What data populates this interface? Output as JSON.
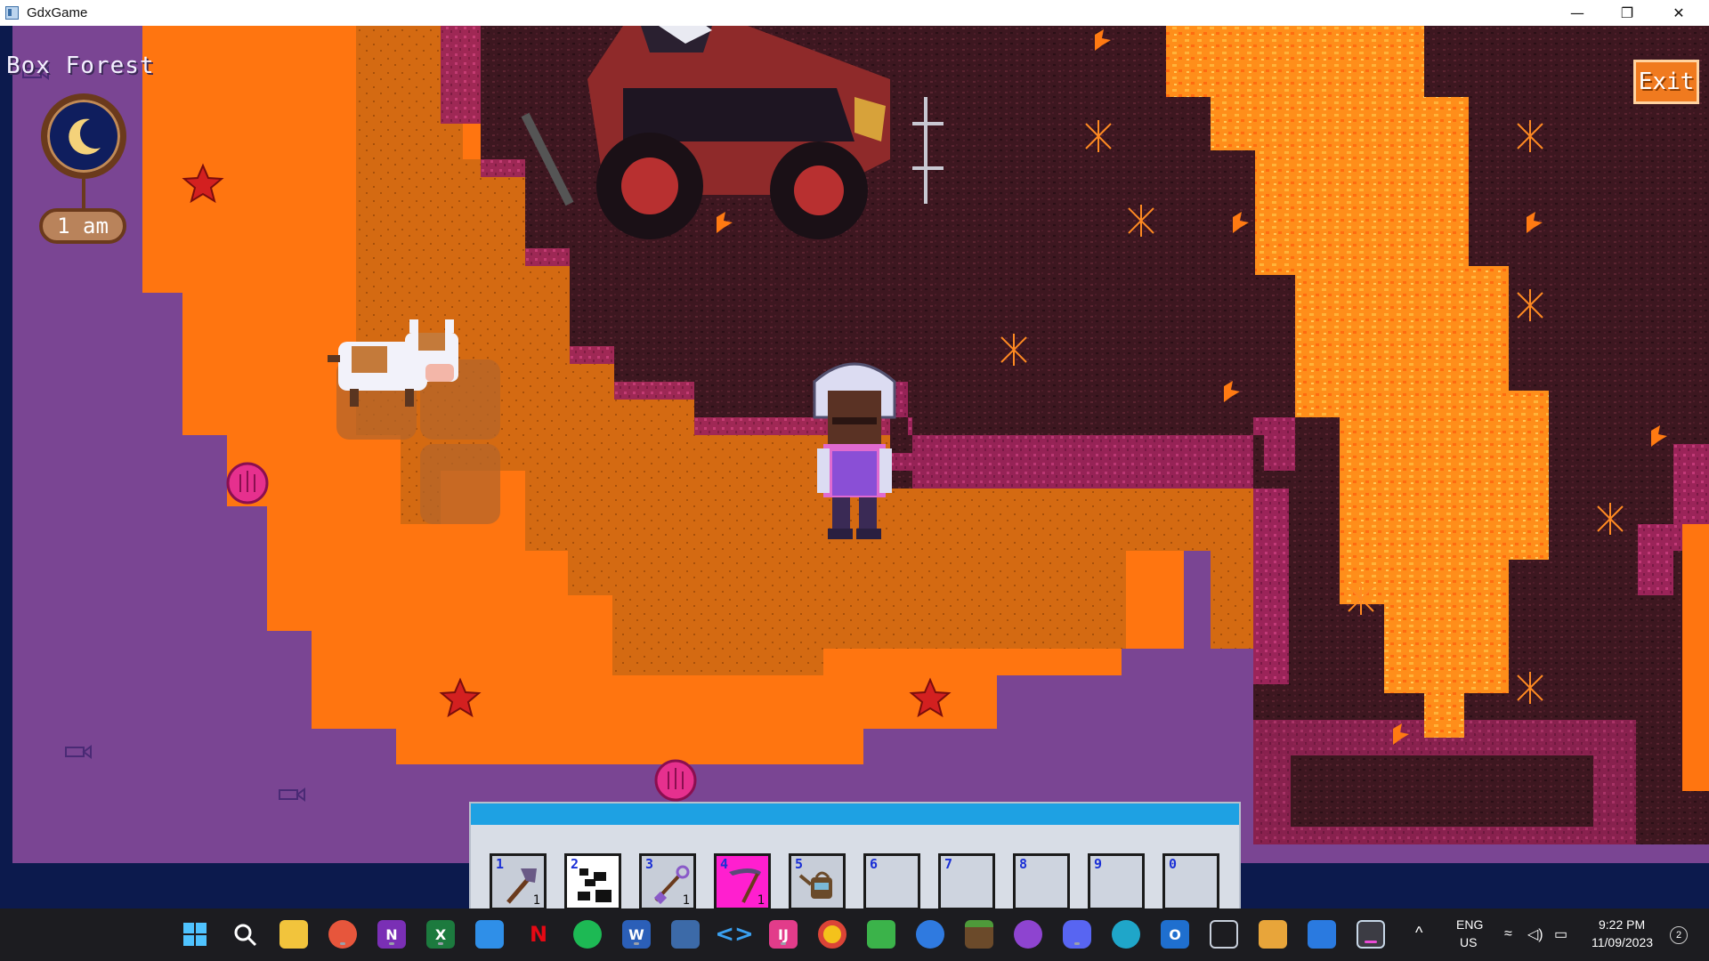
{
  "window": {
    "title": "GdxGame",
    "minimize_glyph": "—",
    "restore_glyph": "❐",
    "close_glyph": "✕"
  },
  "hud": {
    "location": "Box Forest",
    "time": "1 am",
    "exit_label": "Exit",
    "clock_icon": "crescent-moon-icon"
  },
  "hotbar": {
    "selected_index": 3,
    "slots": [
      {
        "number": "1",
        "item": "axe",
        "quantity": "1"
      },
      {
        "number": "2",
        "item": "rock-cluster",
        "quantity": ""
      },
      {
        "number": "3",
        "item": "shovel",
        "quantity": "1"
      },
      {
        "number": "4",
        "item": "scythe",
        "quantity": "1"
      },
      {
        "number": "5",
        "item": "watering-can",
        "quantity": ""
      },
      {
        "number": "6",
        "item": "",
        "quantity": ""
      },
      {
        "number": "7",
        "item": "",
        "quantity": ""
      },
      {
        "number": "8",
        "item": "",
        "quantity": ""
      },
      {
        "number": "9",
        "item": "",
        "quantity": ""
      },
      {
        "number": "0",
        "item": "",
        "quantity": ""
      }
    ]
  },
  "world": {
    "entities": [
      "player-character",
      "cow",
      "vehicle",
      "starfish",
      "seashell",
      "small-fish",
      "lava-sparks"
    ],
    "colors": {
      "sea": "#7a4593",
      "sand": "#ff7510",
      "dirt": "#d46a12",
      "volcanic_rock": "#3d1720",
      "lava": "#ff8e1a",
      "hotbar_header": "#1ea1e3",
      "selected_slot": "#ff1fcf"
    }
  },
  "taskbar": {
    "apps": [
      "windows-start",
      "search",
      "file-explorer",
      "firefox",
      "onenote",
      "excel",
      "calendar",
      "netflix",
      "spotify",
      "word",
      "network",
      "vscode",
      "intellij",
      "chrome",
      "remote-desktop",
      "app-blue",
      "minecraft",
      "github",
      "discord",
      "edge",
      "outlook",
      "3d-viewer",
      "git-kraken",
      "azure-storage",
      "gdxgame"
    ],
    "language": "ENG",
    "region": "US",
    "clock_time": "9:22 PM",
    "clock_date": "11/09/2023",
    "notification_count": "2"
  }
}
